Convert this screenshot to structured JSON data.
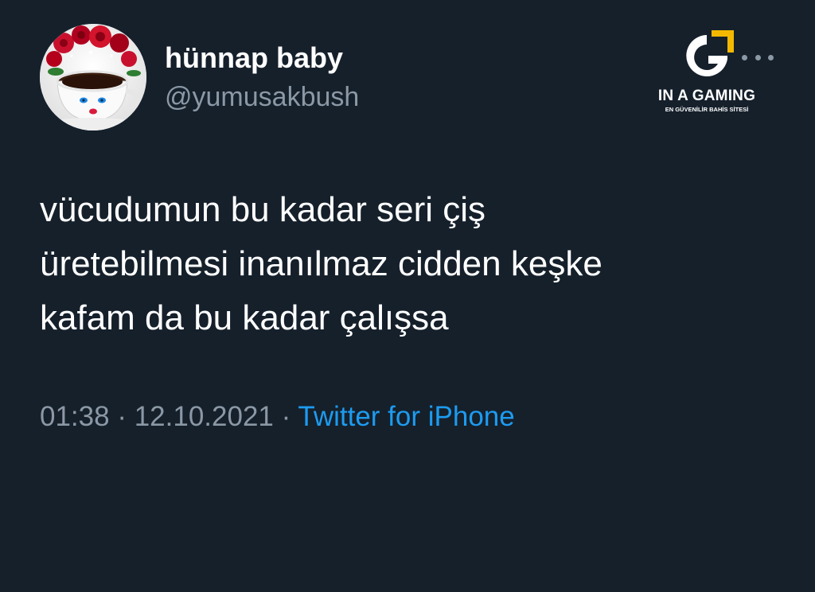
{
  "user": {
    "display_name": "hünnap baby",
    "handle": "@yumusakbush",
    "avatar_icon": "coffee-cup-roses-avatar"
  },
  "tweet": {
    "lines": [
      "vücudumun bu kadar seri çiş",
      "üretebilmesi inanılmaz cidden keşke",
      "kafam da bu kadar çalışsa"
    ],
    "time": "01:38",
    "date": "12.10.2021",
    "separator": "·",
    "source": "Twitter for iPhone"
  },
  "watermark": {
    "title": "IN A GAMING",
    "subtitle": "EN GÜVENİLİR BAHİS SİTESİ",
    "logo_icon": "g-logo-icon"
  },
  "colors": {
    "background": "#15202b",
    "text_primary": "#ffffff",
    "text_secondary": "#8b98a5",
    "link": "#1d9bf0",
    "accent": "#f5b800"
  }
}
